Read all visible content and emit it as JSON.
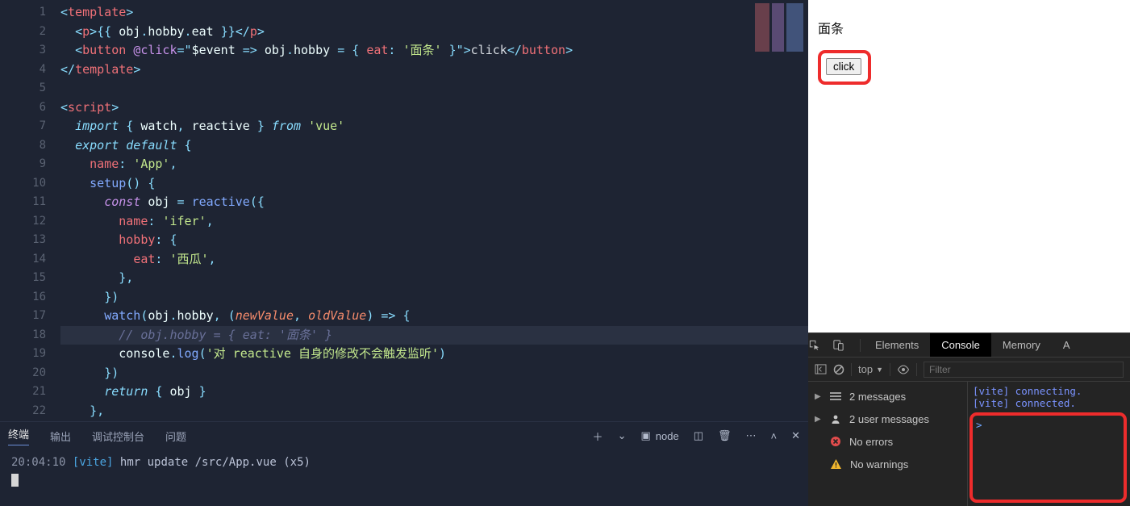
{
  "editor": {
    "lines": [
      {
        "n": 1,
        "html": "<span class='tok-punc'>&lt;</span><span class='tok-tag'>template</span><span class='tok-punc'>&gt;</span>"
      },
      {
        "n": 2,
        "html": "  <span class='tok-punc'>&lt;</span><span class='tok-tag'>p</span><span class='tok-punc'>&gt;</span><span class='tok-punc'>{{</span> <span class='tok-var'>obj</span><span class='tok-punc'>.</span><span class='tok-var'>hobby</span><span class='tok-punc'>.</span><span class='tok-var'>eat</span> <span class='tok-punc'>}}</span><span class='tok-punc'>&lt;/</span><span class='tok-tag'>p</span><span class='tok-punc'>&gt;</span>"
      },
      {
        "n": 3,
        "html": "  <span class='tok-punc'>&lt;</span><span class='tok-tag'>button</span> <span class='tok-attr'>@click</span><span class='tok-op'>=</span><span class='tok-punc'>\"</span><span class='tok-var'>$event</span> <span class='tok-op'>=&gt;</span> <span class='tok-var'>obj</span><span class='tok-punc'>.</span><span class='tok-var'>hobby</span> <span class='tok-op'>=</span> <span class='tok-punc'>{</span> <span class='tok-prop'>eat</span><span class='tok-punc'>:</span> <span class='tok-str'>'面条'</span> <span class='tok-punc'>}</span><span class='tok-punc'>\"&gt;</span><span class='tok-txt'>click</span><span class='tok-punc'>&lt;/</span><span class='tok-tag'>button</span><span class='tok-punc'>&gt;</span>"
      },
      {
        "n": 4,
        "html": "<span class='tok-punc'>&lt;/</span><span class='tok-tag'>template</span><span class='tok-punc'>&gt;</span>"
      },
      {
        "n": 5,
        "html": ""
      },
      {
        "n": 6,
        "html": "<span class='tok-punc'>&lt;</span><span class='tok-tag'>script</span><span class='tok-punc'>&gt;</span>"
      },
      {
        "n": 7,
        "html": "  <span class='tok-kw2'>import</span> <span class='tok-punc'>{</span> <span class='tok-var'>watch</span><span class='tok-punc'>,</span> <span class='tok-var'>reactive</span> <span class='tok-punc'>}</span> <span class='tok-kw2'>from</span> <span class='tok-str'>'vue'</span>"
      },
      {
        "n": 8,
        "html": "  <span class='tok-kw2'>export</span> <span class='tok-kw2'>default</span> <span class='tok-punc'>{</span>"
      },
      {
        "n": 9,
        "html": "    <span class='tok-prop'>name</span><span class='tok-punc'>:</span> <span class='tok-str'>'App'</span><span class='tok-punc'>,</span>"
      },
      {
        "n": 10,
        "html": "    <span class='tok-fn'>setup</span><span class='tok-punc'>()</span> <span class='tok-punc'>{</span>"
      },
      {
        "n": 11,
        "html": "      <span class='tok-kw'>const</span> <span class='tok-var'>obj</span> <span class='tok-op'>=</span> <span class='tok-fn'>reactive</span><span class='tok-punc'>({</span>"
      },
      {
        "n": 12,
        "html": "        <span class='tok-prop'>name</span><span class='tok-punc'>:</span> <span class='tok-str'>'ifer'</span><span class='tok-punc'>,</span>"
      },
      {
        "n": 13,
        "html": "        <span class='tok-prop'>hobby</span><span class='tok-punc'>:</span> <span class='tok-punc'>{</span>"
      },
      {
        "n": 14,
        "html": "          <span class='tok-prop'>eat</span><span class='tok-punc'>:</span> <span class='tok-str'>'西瓜'</span><span class='tok-punc'>,</span>"
      },
      {
        "n": 15,
        "html": "        <span class='tok-punc'>},</span>"
      },
      {
        "n": 16,
        "html": "      <span class='tok-punc'>})</span>"
      },
      {
        "n": 17,
        "html": "      <span class='tok-fn'>watch</span><span class='tok-punc'>(</span><span class='tok-var'>obj</span><span class='tok-punc'>.</span><span class='tok-var'>hobby</span><span class='tok-punc'>,</span> <span class='tok-punc'>(</span><span class='tok-param'>newValue</span><span class='tok-punc'>,</span> <span class='tok-param'>oldValue</span><span class='tok-punc'>)</span> <span class='tok-op'>=&gt;</span> <span class='tok-punc'>{</span>"
      },
      {
        "n": 18,
        "hl": true,
        "html": "        <span class='tok-cmt'>// obj.hobby = { eat: '面条' }</span>"
      },
      {
        "n": 19,
        "html": "        <span class='tok-var'>console</span><span class='tok-punc'>.</span><span class='tok-fn'>log</span><span class='tok-punc'>(</span><span class='tok-str'>'对 reactive 自身的修改不会触发监听'</span><span class='tok-punc'>)</span>"
      },
      {
        "n": 20,
        "html": "      <span class='tok-punc'>})</span>"
      },
      {
        "n": 21,
        "html": "      <span class='tok-kw2'>return</span> <span class='tok-punc'>{</span> <span class='tok-var'>obj</span> <span class='tok-punc'>}</span>"
      },
      {
        "n": 22,
        "html": "    <span class='tok-punc'>},</span>"
      }
    ]
  },
  "terminal": {
    "tabs": [
      "终端",
      "输出",
      "调试控制台",
      "问题"
    ],
    "active_tab": 0,
    "shell_label": "node",
    "time": "20:04:10",
    "prefix": "[vite]",
    "msg": "hmr update",
    "path": "/src/App.vue",
    "count": "(x5)"
  },
  "browser": {
    "output_text": "面条",
    "button_label": "click"
  },
  "devtools": {
    "tabs": [
      "Elements",
      "Console",
      "Memory",
      "A"
    ],
    "active_tab": 1,
    "context": "top",
    "filter_placeholder": "Filter",
    "sidebar": [
      {
        "icon": "list",
        "label": "2 messages",
        "tri": true
      },
      {
        "icon": "user",
        "label": "2 user messages",
        "tri": true
      },
      {
        "icon": "error",
        "label": "No errors",
        "tri": false
      },
      {
        "icon": "warn",
        "label": "No warnings",
        "tri": false
      }
    ],
    "console_lines": [
      "[vite] connecting.",
      "[vite] connected."
    ],
    "prompt": ">"
  }
}
